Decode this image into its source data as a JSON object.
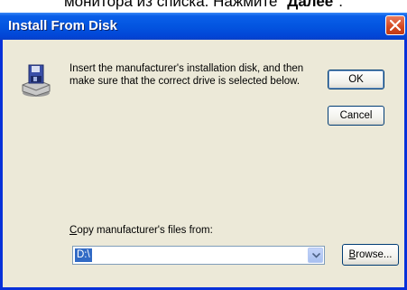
{
  "caption": {
    "text_before": "монитора из списка. Нажмите \"",
    "text_bold": "Далее",
    "text_after": "\"."
  },
  "dialog": {
    "title": "Install From Disk",
    "instructions": "Insert the manufacturer's installation disk, and then make sure that the correct drive is selected below.",
    "ok_label": "OK",
    "cancel_label": "Cancel",
    "copy_label_accel": "C",
    "copy_label_rest": "opy manufacturer's files from:",
    "path_value": "D:\\",
    "browse_label_accel": "B",
    "browse_label_rest": "rowse..."
  },
  "icons": {
    "disk": "floppy-disk-drive-icon",
    "close": "close-icon",
    "dropdown": "chevron-down-icon"
  },
  "colors": {
    "titlebar": "#0355e0",
    "window_bg": "#ece9d8",
    "close_button": "#d4481f",
    "selection": "#316ac5"
  }
}
